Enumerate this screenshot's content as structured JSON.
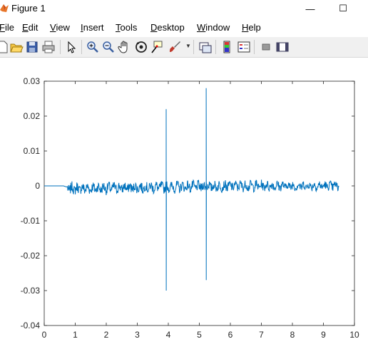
{
  "window": {
    "title": "Figure 1",
    "minimize_glyph": "—",
    "maximize_glyph": "☐"
  },
  "menu": {
    "items": [
      {
        "pre": "",
        "acc": "F",
        "post": "ile"
      },
      {
        "pre": "",
        "acc": "E",
        "post": "dit"
      },
      {
        "pre": "",
        "acc": "V",
        "post": "iew"
      },
      {
        "pre": "",
        "acc": "I",
        "post": "nsert"
      },
      {
        "pre": "",
        "acc": "T",
        "post": "ools"
      },
      {
        "pre": "",
        "acc": "D",
        "post": "esktop"
      },
      {
        "pre": "",
        "acc": "W",
        "post": "indow"
      },
      {
        "pre": "",
        "acc": "H",
        "post": "elp"
      }
    ]
  },
  "toolbar": {
    "icons": [
      "new-figure-icon",
      "open-file-icon",
      "save-icon",
      "print-icon",
      "edit-plot-arrow-icon",
      "zoom-in-icon",
      "zoom-out-icon",
      "pan-hand-icon",
      "rotate-3d-icon",
      "data-cursor-icon",
      "brush-icon",
      "link-plot-icon",
      "insert-colorbar-icon",
      "insert-legend-icon",
      "hide-plot-tools-icon",
      "show-plot-tools-icon"
    ]
  },
  "chart_data": {
    "type": "line",
    "title": "",
    "xlabel": "",
    "ylabel": "",
    "xlim": [
      0,
      10
    ],
    "ylim": [
      -0.04,
      0.03
    ],
    "xticks": [
      "0",
      "1",
      "2",
      "3",
      "4",
      "5",
      "6",
      "7",
      "8",
      "9",
      "10"
    ],
    "yticks": [
      "0.03",
      "0.02",
      "0.01",
      "0",
      "-0.01",
      "-0.02",
      "-0.03",
      "-0.04"
    ],
    "grid": false,
    "line_color": "#0072bd",
    "series": [
      {
        "description_points": [
          [
            0.0,
            0.0
          ],
          [
            0.6,
            0.0
          ],
          [
            0.7,
            -0.0002
          ],
          [
            0.78,
            -0.0015
          ],
          [
            0.85,
            -0.0025
          ],
          [
            3.9,
            -0.001
          ],
          [
            3.92,
            0.022
          ],
          [
            3.93,
            -0.03
          ],
          [
            3.95,
            0.002
          ],
          [
            5.2,
            -0.001
          ],
          [
            5.22,
            0.028
          ],
          [
            5.23,
            -0.027
          ],
          [
            5.25,
            0.001
          ],
          [
            9.5,
            0.0005
          ]
        ],
        "noise_start_x": 0.75,
        "noise_end_x": 9.5,
        "noise_amplitude_early": 0.0015,
        "noise_amplitude_late": 0.0012,
        "baseline_early": -0.0008,
        "baseline_late": 0.0,
        "spikes": [
          {
            "x": 3.93,
            "max": 0.022,
            "min": -0.03
          },
          {
            "x": 5.22,
            "max": 0.028,
            "min": -0.027
          }
        ]
      }
    ]
  }
}
